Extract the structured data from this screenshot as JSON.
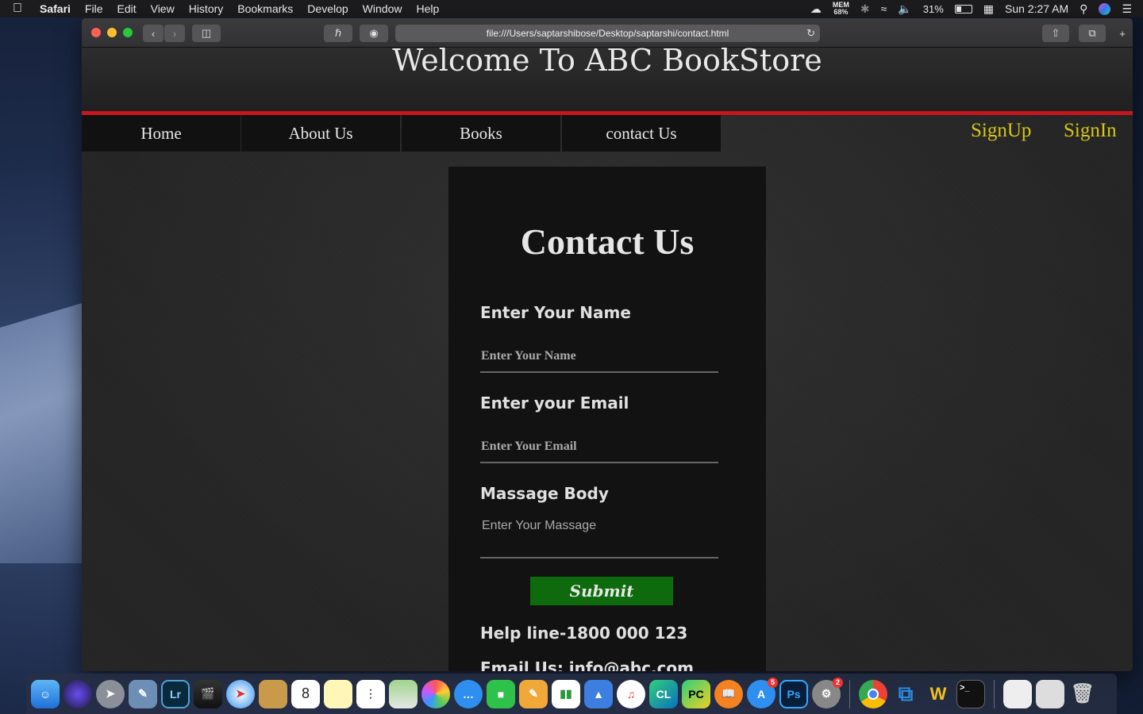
{
  "menubar": {
    "app": "Safari",
    "items": [
      "File",
      "Edit",
      "View",
      "History",
      "Bookmarks",
      "Develop",
      "Window",
      "Help"
    ],
    "mem_label": "MEM",
    "mem_value": "68%",
    "battery": "31%",
    "clock": "Sun 2:27 AM"
  },
  "browser": {
    "url": "file:///Users/saptarshibose/Desktop/saptarshi/contact.html"
  },
  "site": {
    "title": "Welcome To ABC BookStore",
    "nav": [
      "Home",
      "About Us",
      "Books",
      "contact Us"
    ],
    "signup": "SignUp",
    "signin": "SignIn"
  },
  "contact": {
    "heading": "Contact Us",
    "name_label": "Enter Your Name",
    "name_placeholder": "Enter Your Name",
    "email_label": "Enter your Email",
    "email_placeholder": "Enter Your Email",
    "message_label": "Massage Body",
    "message_placeholder": "Enter Your Massage",
    "submit_label": "Submit",
    "helpline": "Help line-1800 000 123",
    "email_info": "Email Us: info@abc.com"
  },
  "colors": {
    "accent_red": "#c8161d",
    "auth_yellow": "#d8c51a",
    "submit_green": "#0d6b0d"
  },
  "dock": {
    "icons": [
      "finder-icon",
      "siri-icon",
      "launchpad-icon",
      "preview-icon",
      "lightroom-icon",
      "final-cut-icon",
      "safari-icon",
      "notefile-icon",
      "calendar-icon",
      "notes-icon",
      "reminders-icon",
      "maps-icon",
      "photos-icon",
      "messages-icon",
      "facetime-icon",
      "pages-icon",
      "numbers-icon",
      "keynote-icon",
      "itunes-icon",
      "clion-icon",
      "pycharm-icon",
      "ibooks-icon",
      "app-store-icon",
      "photoshop-icon",
      "system-preferences-icon",
      "chrome-icon",
      "vscode-icon",
      "cleaner-icon",
      "terminal-icon",
      "sql-file-icon",
      "screenshot-icon",
      "trash-icon"
    ],
    "lr_label": "Lr",
    "ps_label": "Ps",
    "cl_label": "CL",
    "pc_label": "PC",
    "calendar_day": "8",
    "app_store_badge": "5",
    "sysprefs_badge": "2"
  }
}
